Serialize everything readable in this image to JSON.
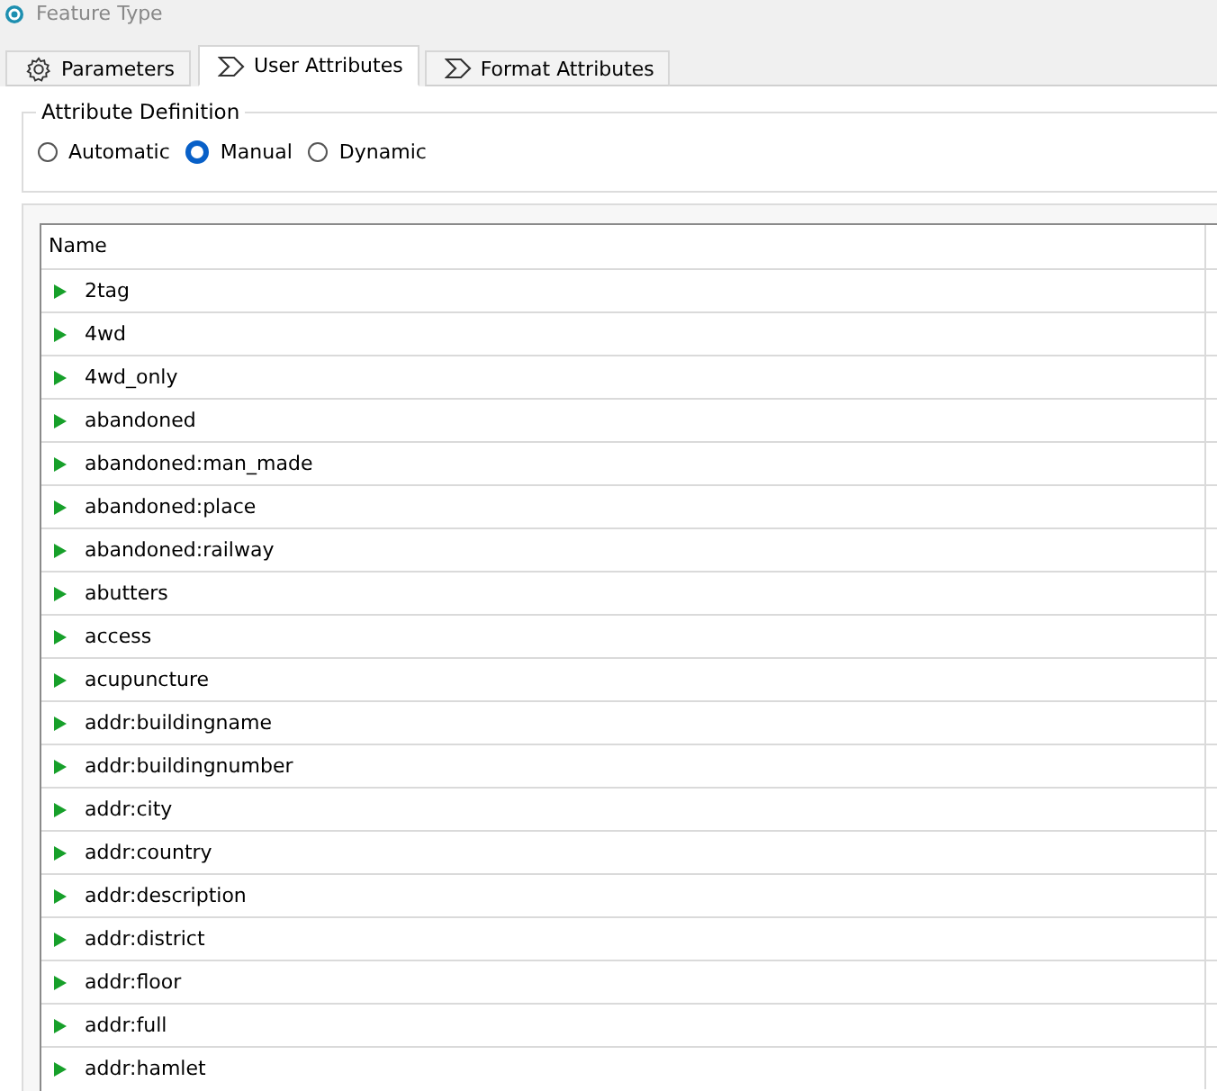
{
  "window": {
    "title": "Feature Type"
  },
  "tabs": [
    {
      "label": "Parameters",
      "kind": "settings",
      "selected": false
    },
    {
      "label": "User Attributes",
      "kind": "attributes",
      "selected": true
    },
    {
      "label": "Format Attributes",
      "kind": "attributes",
      "selected": false
    }
  ],
  "attribute_definition": {
    "title": "Attribute Definition",
    "options": [
      {
        "label": "Automatic",
        "selected": false
      },
      {
        "label": "Manual",
        "selected": true
      },
      {
        "label": "Dynamic",
        "selected": false
      }
    ]
  },
  "table": {
    "columns": [
      "Name"
    ],
    "rows": [
      {
        "name": "2tag"
      },
      {
        "name": "4wd"
      },
      {
        "name": "4wd_only"
      },
      {
        "name": "abandoned"
      },
      {
        "name": "abandoned:man_made"
      },
      {
        "name": "abandoned:place"
      },
      {
        "name": "abandoned:railway"
      },
      {
        "name": "abutters"
      },
      {
        "name": "access"
      },
      {
        "name": "acupuncture"
      },
      {
        "name": "addr:buildingname"
      },
      {
        "name": "addr:buildingnumber"
      },
      {
        "name": "addr:city"
      },
      {
        "name": "addr:country"
      },
      {
        "name": "addr:description"
      },
      {
        "name": "addr:district"
      },
      {
        "name": "addr:floor"
      },
      {
        "name": "addr:full"
      },
      {
        "name": "addr:hamlet"
      }
    ]
  }
}
